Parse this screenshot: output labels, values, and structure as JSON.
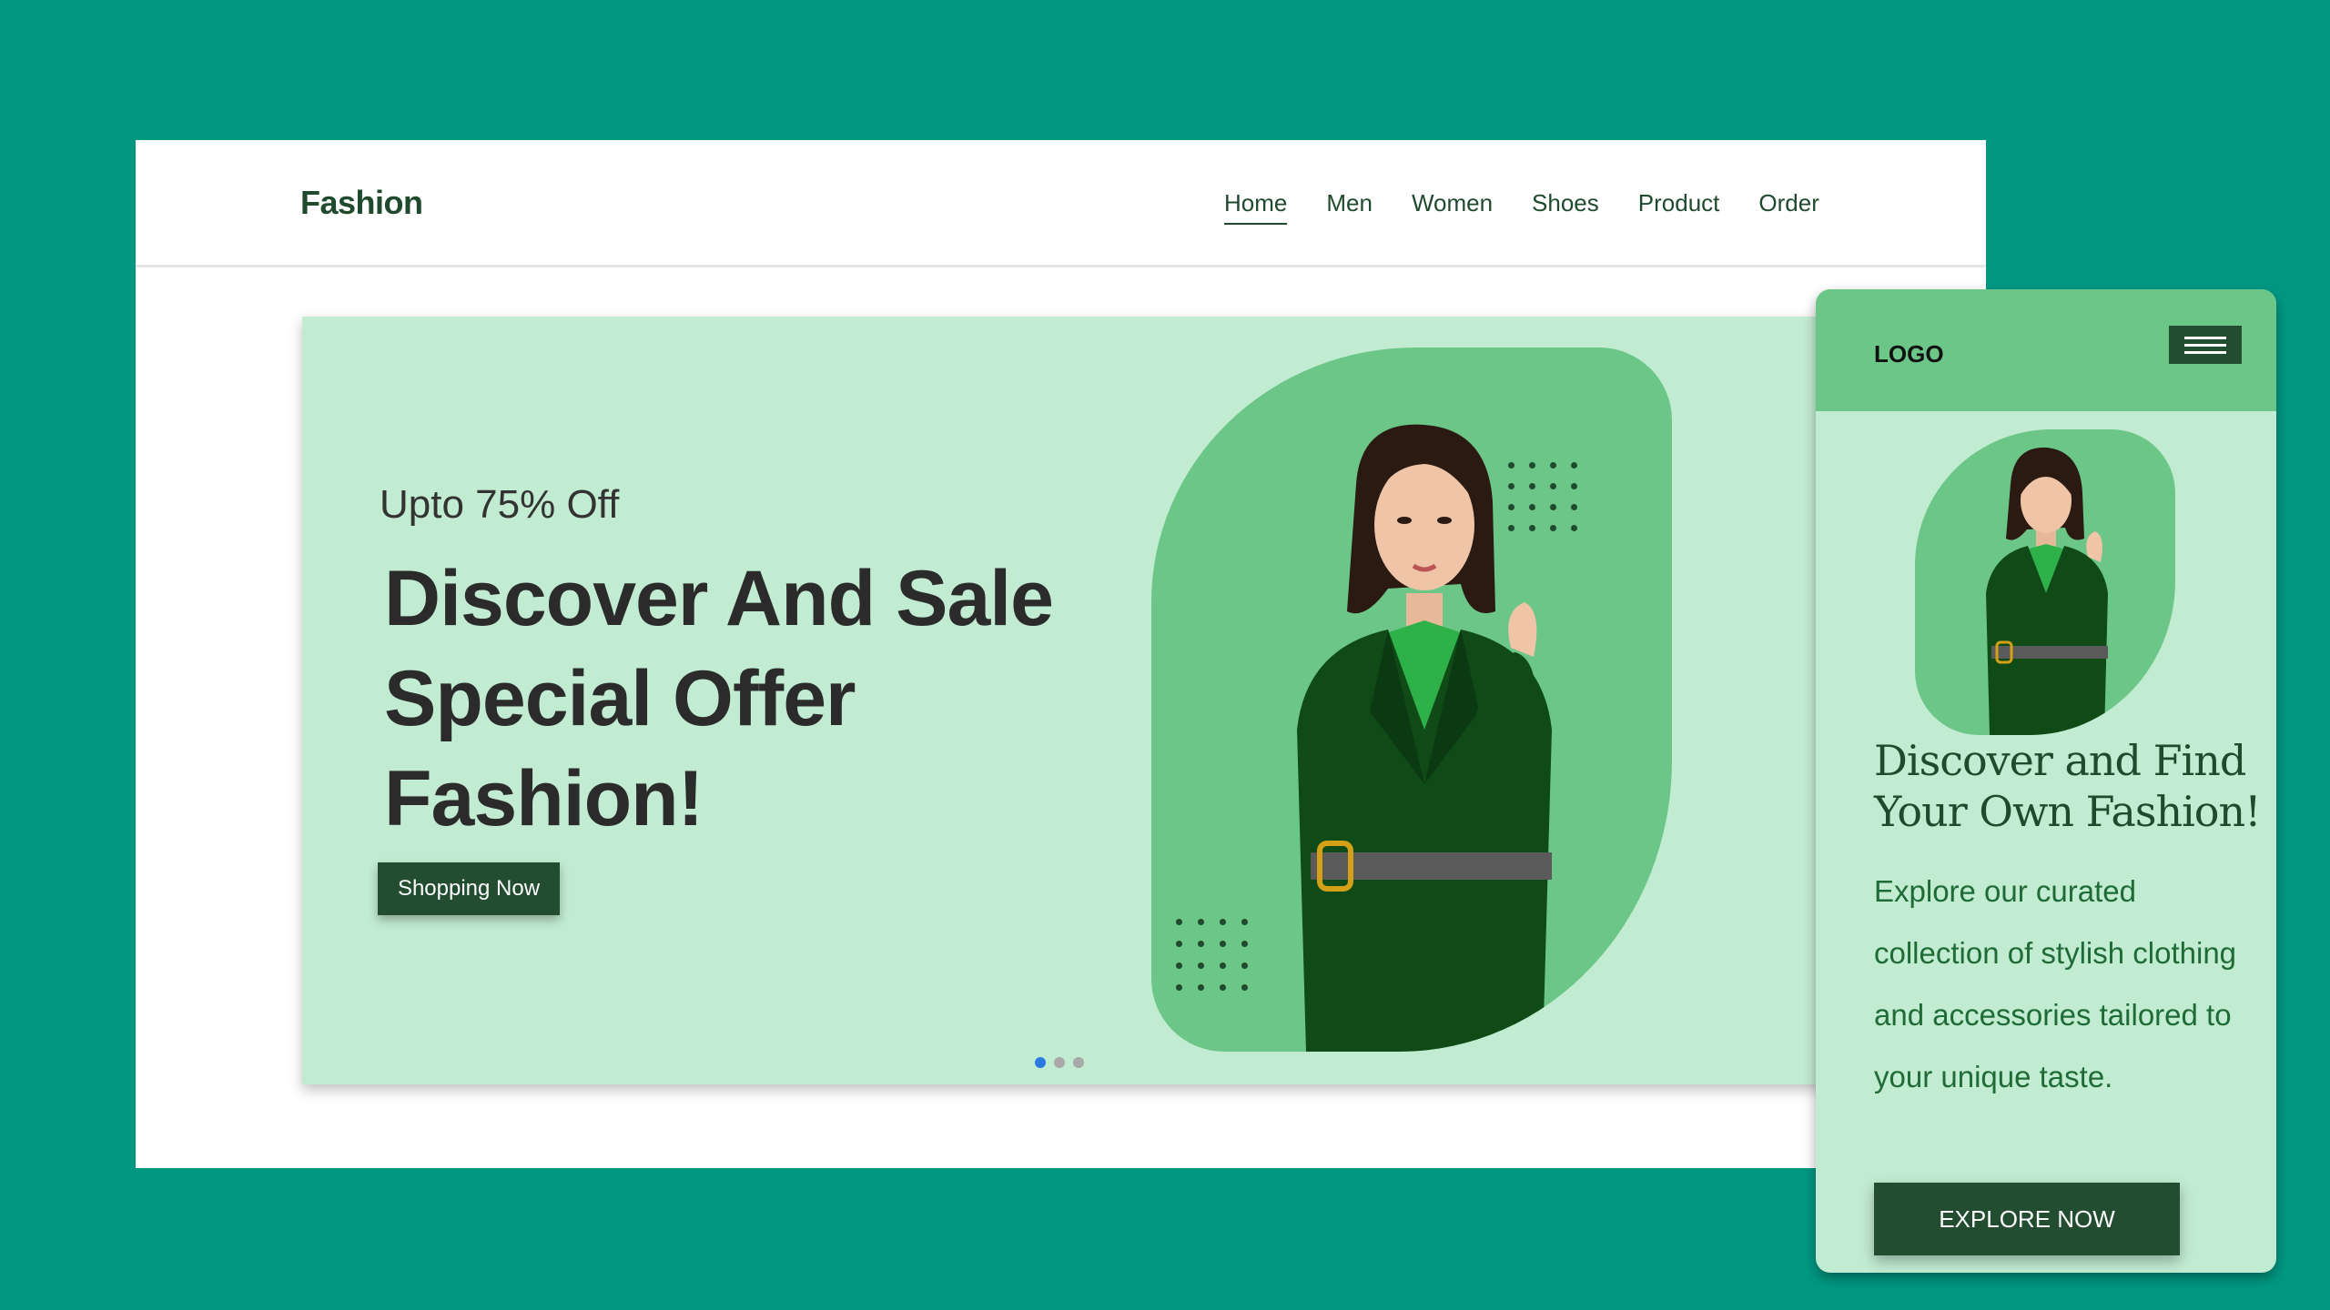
{
  "desktop": {
    "logo": "Fashion",
    "nav": [
      "Home",
      "Men",
      "Women",
      "Shoes",
      "Product",
      "Order"
    ],
    "active_nav": "Home",
    "hero": {
      "subtitle": "Upto 75% Off",
      "title": "Discover And Sale Special Offer Fashion!",
      "button": "Shopping Now",
      "slides_total": 3,
      "active_slide": 1
    }
  },
  "mobile": {
    "logo": "LOGO",
    "title": "Discover and Find Your Own Fashion!",
    "text": "Explore our curated collection of stylish clothing and accessories tailored to your unique taste.",
    "button": "EXPLORE NOW"
  },
  "colors": {
    "background": "#019882",
    "hero_bg": "#c2ecd2",
    "accent": "#6cc687",
    "button": "#234d31"
  }
}
